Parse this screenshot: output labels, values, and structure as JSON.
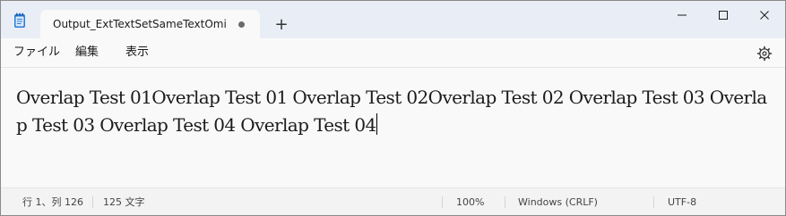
{
  "tab": {
    "title": "Output_ExtTextSetSameTextOmitRa",
    "unsaved": true
  },
  "titlebar": {
    "new_tab_symbol": "+"
  },
  "menu": {
    "file": "ファイル",
    "edit": "編集",
    "view": "表示"
  },
  "editor": {
    "text": "Overlap Test 01Overlap Test 01 Overlap Test 02Overlap Test 02 Overlap Test 03 Overlap Test 03 Overlap Test 04 Overlap Test 04"
  },
  "status": {
    "position": "行 1、列 126",
    "char_count": "125 文字",
    "zoom": "100%",
    "line_ending": "Windows (CRLF)",
    "encoding": "UTF-8"
  },
  "icons": {
    "app": "notepad-icon",
    "settings": "gear-icon",
    "minimize": "minimize-icon",
    "maximize": "maximize-icon",
    "close": "close-icon"
  },
  "colors": {
    "titlebar": "#e9eef6",
    "editor_background": "#f9f9f9",
    "statusbar": "#f3f3f3"
  }
}
